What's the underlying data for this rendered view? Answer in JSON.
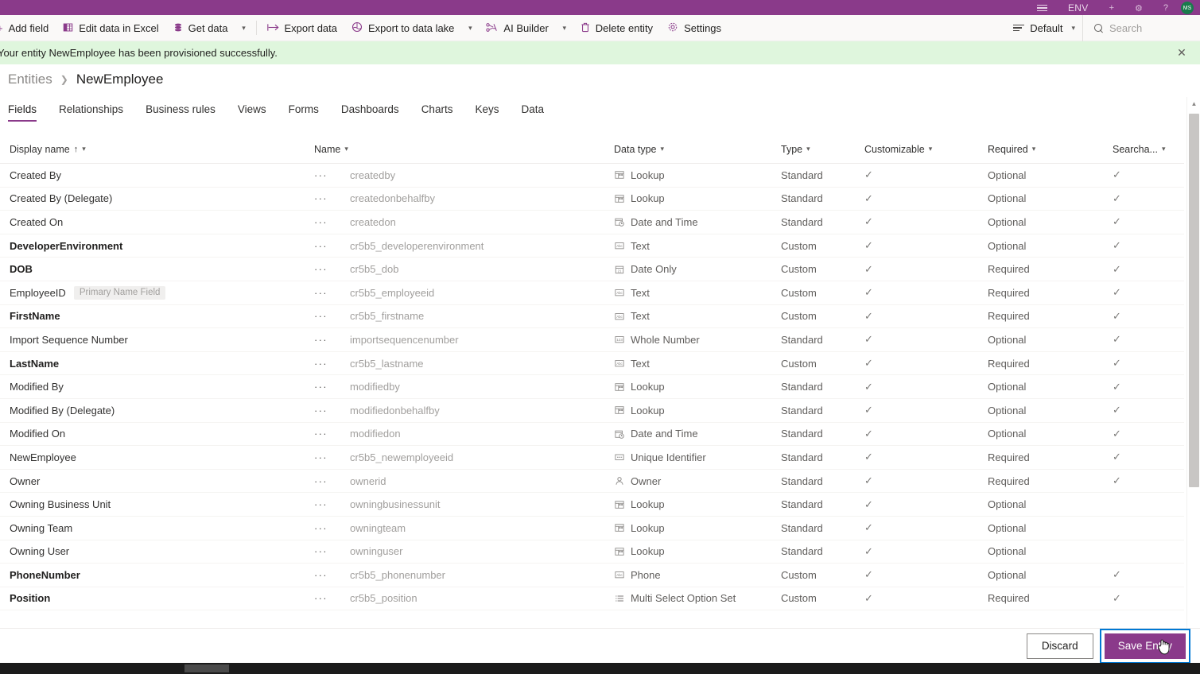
{
  "appbar": {
    "title": "ENV",
    "icons": [
      "hamburger-icon",
      "plus-icon",
      "gear-icon",
      "help-icon"
    ],
    "avatar_initials": "MS",
    "background": "#8A3A8A"
  },
  "commandbar": {
    "items": [
      {
        "label": "Add field",
        "icon": "plus-icon",
        "has_caret": false
      },
      {
        "label": "Edit data in Excel",
        "icon": "excel-icon",
        "has_caret": false
      },
      {
        "label": "Get data",
        "icon": "database-icon",
        "has_caret": true
      },
      {
        "label": "Export data",
        "icon": "export-icon",
        "has_caret": false
      },
      {
        "label": "Export to data lake",
        "icon": "data-lake-icon",
        "has_caret": true
      },
      {
        "label": "AI Builder",
        "icon": "ai-builder-icon",
        "has_caret": true
      },
      {
        "label": "Delete entity",
        "icon": "trash-icon",
        "has_caret": false
      },
      {
        "label": "Settings",
        "icon": "gear-icon",
        "has_caret": false
      }
    ],
    "view_picker": {
      "label": "Default",
      "icon": "view-list-icon"
    },
    "search": {
      "placeholder": "Search",
      "value": "",
      "icon": "search-icon"
    }
  },
  "notification": {
    "message": "Your entity NewEmployee has been provisioned successfully.",
    "background": "#dff6dd",
    "close_label": "✕"
  },
  "breadcrumb": {
    "parent": "Entities",
    "separator": "❯",
    "current": "NewEmployee"
  },
  "tabs": [
    {
      "label": "Fields",
      "active": true
    },
    {
      "label": "Relationships",
      "active": false
    },
    {
      "label": "Business rules",
      "active": false
    },
    {
      "label": "Views",
      "active": false
    },
    {
      "label": "Forms",
      "active": false
    },
    {
      "label": "Dashboards",
      "active": false
    },
    {
      "label": "Charts",
      "active": false
    },
    {
      "label": "Keys",
      "active": false
    },
    {
      "label": "Data",
      "active": false
    }
  ],
  "grid": {
    "columns": [
      {
        "label": "Display name",
        "sorted": "asc",
        "sort_glyph": "↑"
      },
      {
        "label": "Name"
      },
      {
        "label": "Data type"
      },
      {
        "label": "Type"
      },
      {
        "label": "Customizable"
      },
      {
        "label": "Required"
      },
      {
        "label": "Searcha..."
      }
    ],
    "row_menu_glyph": "···",
    "check_glyph": "✓",
    "rows": [
      {
        "display_name": "Created By",
        "bold": false,
        "badge": "",
        "name": "createdby",
        "data_type": "Lookup",
        "type_icon": "lookup-icon",
        "type": "Standard",
        "customizable": true,
        "required": "Optional",
        "searchable": true
      },
      {
        "display_name": "Created By (Delegate)",
        "bold": false,
        "badge": "",
        "name": "createdonbehalfby",
        "data_type": "Lookup",
        "type_icon": "lookup-icon",
        "type": "Standard",
        "customizable": true,
        "required": "Optional",
        "searchable": true
      },
      {
        "display_name": "Created On",
        "bold": false,
        "badge": "",
        "name": "createdon",
        "data_type": "Date and Time",
        "type_icon": "date-time-icon",
        "type": "Standard",
        "customizable": true,
        "required": "Optional",
        "searchable": true
      },
      {
        "display_name": "DeveloperEnvironment",
        "bold": true,
        "badge": "",
        "name": "cr5b5_developerenvironment",
        "data_type": "Text",
        "type_icon": "text-icon",
        "type": "Custom",
        "customizable": true,
        "required": "Optional",
        "searchable": true
      },
      {
        "display_name": "DOB",
        "bold": true,
        "badge": "",
        "name": "cr5b5_dob",
        "data_type": "Date Only",
        "type_icon": "date-only-icon",
        "type": "Custom",
        "customizable": true,
        "required": "Required",
        "searchable": true
      },
      {
        "display_name": "EmployeeID",
        "bold": false,
        "badge": "Primary Name Field",
        "name": "cr5b5_employeeid",
        "data_type": "Text",
        "type_icon": "text-icon",
        "type": "Custom",
        "customizable": true,
        "required": "Required",
        "searchable": true
      },
      {
        "display_name": "FirstName",
        "bold": true,
        "badge": "",
        "name": "cr5b5_firstname",
        "data_type": "Text",
        "type_icon": "text-icon",
        "type": "Custom",
        "customizable": true,
        "required": "Required",
        "searchable": true
      },
      {
        "display_name": "Import Sequence Number",
        "bold": false,
        "badge": "",
        "name": "importsequencenumber",
        "data_type": "Whole Number",
        "type_icon": "whole-number-icon",
        "type": "Standard",
        "customizable": true,
        "required": "Optional",
        "searchable": true
      },
      {
        "display_name": "LastName",
        "bold": true,
        "badge": "",
        "name": "cr5b5_lastname",
        "data_type": "Text",
        "type_icon": "text-icon",
        "type": "Custom",
        "customizable": true,
        "required": "Required",
        "searchable": true
      },
      {
        "display_name": "Modified By",
        "bold": false,
        "badge": "",
        "name": "modifiedby",
        "data_type": "Lookup",
        "type_icon": "lookup-icon",
        "type": "Standard",
        "customizable": true,
        "required": "Optional",
        "searchable": true
      },
      {
        "display_name": "Modified By (Delegate)",
        "bold": false,
        "badge": "",
        "name": "modifiedonbehalfby",
        "data_type": "Lookup",
        "type_icon": "lookup-icon",
        "type": "Standard",
        "customizable": true,
        "required": "Optional",
        "searchable": true
      },
      {
        "display_name": "Modified On",
        "bold": false,
        "badge": "",
        "name": "modifiedon",
        "data_type": "Date and Time",
        "type_icon": "date-time-icon",
        "type": "Standard",
        "customizable": true,
        "required": "Optional",
        "searchable": true
      },
      {
        "display_name": "NewEmployee",
        "bold": false,
        "badge": "",
        "name": "cr5b5_newemployeeid",
        "data_type": "Unique Identifier",
        "type_icon": "unique-id-icon",
        "type": "Standard",
        "customizable": true,
        "required": "Required",
        "searchable": true
      },
      {
        "display_name": "Owner",
        "bold": false,
        "badge": "",
        "name": "ownerid",
        "data_type": "Owner",
        "type_icon": "owner-icon",
        "type": "Standard",
        "customizable": true,
        "required": "Required",
        "searchable": true
      },
      {
        "display_name": "Owning Business Unit",
        "bold": false,
        "badge": "",
        "name": "owningbusinessunit",
        "data_type": "Lookup",
        "type_icon": "lookup-icon",
        "type": "Standard",
        "customizable": true,
        "required": "Optional",
        "searchable": false
      },
      {
        "display_name": "Owning Team",
        "bold": false,
        "badge": "",
        "name": "owningteam",
        "data_type": "Lookup",
        "type_icon": "lookup-icon",
        "type": "Standard",
        "customizable": true,
        "required": "Optional",
        "searchable": false
      },
      {
        "display_name": "Owning User",
        "bold": false,
        "badge": "",
        "name": "owninguser",
        "data_type": "Lookup",
        "type_icon": "lookup-icon",
        "type": "Standard",
        "customizable": true,
        "required": "Optional",
        "searchable": false
      },
      {
        "display_name": "PhoneNumber",
        "bold": true,
        "badge": "",
        "name": "cr5b5_phonenumber",
        "data_type": "Phone",
        "type_icon": "phone-icon",
        "type": "Custom",
        "customizable": true,
        "required": "Optional",
        "searchable": true
      },
      {
        "display_name": "Position",
        "bold": true,
        "badge": "",
        "name": "cr5b5_position",
        "data_type": "Multi Select Option Set",
        "type_icon": "multi-select-icon",
        "type": "Custom",
        "customizable": true,
        "required": "Required",
        "searchable": true
      }
    ]
  },
  "footer": {
    "discard_label": "Discard",
    "save_label": "Save Entity",
    "save_focused": true,
    "focus_ring_color": "#0078d4",
    "primary_color": "#8A3A8A"
  },
  "scrollbar": {
    "up_glyph": "▲",
    "down_glyph": "▼"
  }
}
